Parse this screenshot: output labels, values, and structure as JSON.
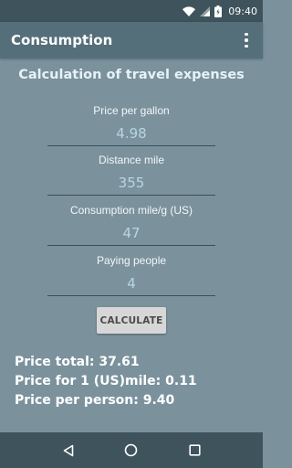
{
  "status_bar": {
    "time": "09:40",
    "icons": [
      "wifi-icon",
      "signal-icon",
      "battery-icon"
    ]
  },
  "app_bar": {
    "title": "Consumption",
    "menu_icon": "overflow-menu-icon"
  },
  "form": {
    "heading": "Calculation of travel expenses",
    "fields": [
      {
        "label": "Price per gallon",
        "value": "4.98"
      },
      {
        "label": "Distance mile",
        "value": "355"
      },
      {
        "label": "Consumption mile/g (US)",
        "value": "47"
      },
      {
        "label": "Paying people",
        "value": "4"
      }
    ],
    "button_label": "CALCULATE"
  },
  "results": {
    "price_total": "Price total: 37.61",
    "price_per_mile": "Price for 1 (US)mile: 0.11",
    "price_per_person": "Price per person: 9.40"
  },
  "nav_bar": {
    "icons": [
      "back-icon",
      "home-icon",
      "recents-icon"
    ]
  },
  "colors": {
    "background": "#7b929d",
    "app_bar": "#546e7a",
    "status_bar": "#3f535c",
    "input_text": "#b6d6e1",
    "button": "#d7d7d7"
  }
}
